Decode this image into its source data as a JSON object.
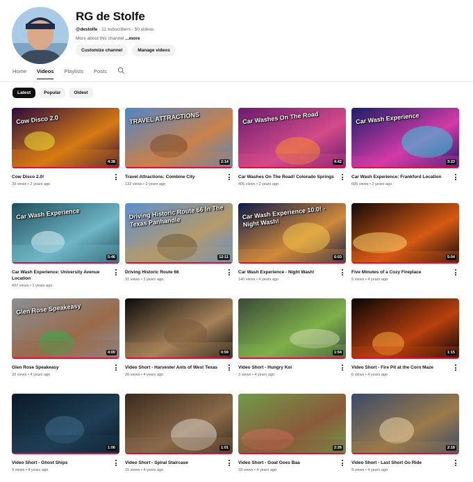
{
  "channel": {
    "name": "RG de Stolfe",
    "handle": "@destolfe",
    "subscribers": "11 subscribers",
    "videos_count": "50 videos",
    "about_text": "More about this channel",
    "about_more": "...more",
    "customize_label": "Customize channel",
    "manage_label": "Manage videos"
  },
  "tabs": [
    {
      "label": "Home",
      "active": false
    },
    {
      "label": "Videos",
      "active": true
    },
    {
      "label": "Playlists",
      "active": false
    },
    {
      "label": "Posts",
      "active": false
    }
  ],
  "filters": [
    {
      "label": "Latest",
      "active": true
    },
    {
      "label": "Popular",
      "active": false
    },
    {
      "label": "Oldest",
      "active": false
    }
  ],
  "videos": [
    {
      "title": "Cow Disco 2.0!",
      "meta": "39 views • 2 years ago",
      "duration": "4:38",
      "thumb_text": "Cow Disco 2.0",
      "palette": [
        "#2b0a3d",
        "#d67a12",
        "#f2e034"
      ]
    },
    {
      "title": "Travel Attractions: Combine City",
      "meta": "132 views • 2 years ago",
      "duration": "2:14",
      "thumb_text": "TRAVEL ATTRACTIONS",
      "palette": [
        "#4f86c6",
        "#c9824a",
        "#7a4a2a"
      ]
    },
    {
      "title": "Car Washes On The Road! Colorado Springs",
      "meta": "406 views • 2 years ago",
      "duration": "4:42",
      "thumb_text": "Car Washes On The Road",
      "palette": [
        "#6a1c6e",
        "#d44a8a",
        "#f58a2a"
      ]
    },
    {
      "title": "Car Wash Experience: Frankford Location",
      "meta": "605 views • 2 years ago",
      "duration": "3:23",
      "thumb_text": "Car Wash Experience",
      "palette": [
        "#1a1f6b",
        "#d43aa8",
        "#2ad2e0"
      ]
    },
    {
      "title": "Car Wash Experience: University Avenue Location",
      "meta": "437 views • 2 years ago",
      "duration": "5:46",
      "thumb_text": "Car Wash Experience",
      "palette": [
        "#1d4e5c",
        "#6fb6c6",
        "#d8eef2"
      ]
    },
    {
      "title": "Driving Historic Route 66",
      "meta": "31 views • 3 years ago",
      "duration": "12:11",
      "thumb_text": "Driving Historic Route 66 In The Texas Panhandle",
      "palette": [
        "#5b8fd0",
        "#b59a6a",
        "#6d5a3a"
      ]
    },
    {
      "title": "Car Wash Experience - Night Wash!",
      "meta": "140 views • 4 years ago",
      "duration": "6:03",
      "thumb_text": "Car Wash Experience 10.0! - Night Wash!",
      "palette": [
        "#0d1a4a",
        "#d08a3a",
        "#f2c24a"
      ]
    },
    {
      "title": "Five Minutes of a Cozy Fireplace",
      "meta": "5 views • 4 years ago",
      "duration": "5:04",
      "thumb_text": "",
      "palette": [
        "#120a08",
        "#d65a14",
        "#fbd16a"
      ]
    },
    {
      "title": "Glen Rose Speakeasy",
      "meta": "33 views • 4 years ago",
      "duration": "4:00",
      "thumb_text": "Glen Rose Speakeasy",
      "palette": [
        "#8a8f95",
        "#9a6a4a",
        "#2fae4a"
      ]
    },
    {
      "title": "Video Short - Harvester Ants of West Texas",
      "meta": "20 views • 4 years ago",
      "duration": "0:59",
      "thumb_text": "",
      "palette": [
        "#0a0a0a",
        "#a6825a",
        "#7a5a3a"
      ]
    },
    {
      "title": "Video Short - Hungry Koi",
      "meta": "3 views • 4 years ago",
      "duration": "1:54",
      "thumb_text": "",
      "palette": [
        "#3a4a3a",
        "#7fb04a",
        "#c8d8a8"
      ]
    },
    {
      "title": "Video Short - Fire Pit at the Corn Maze",
      "meta": "6 views • 4 years ago",
      "duration": "1:15",
      "thumb_text": "",
      "palette": [
        "#080606",
        "#b8400e",
        "#f5a53a"
      ]
    },
    {
      "title": "Video Short - Ghost Ships",
      "meta": "9 views • 4 years ago",
      "duration": "1:06",
      "thumb_text": "",
      "palette": [
        "#0a1a26",
        "#1f3e55",
        "#3e6a86"
      ]
    },
    {
      "title": "Video Short - Spiral Staircase",
      "meta": "15 views • 4 years ago",
      "duration": "1:01",
      "thumb_text": "",
      "palette": [
        "#3a2a1c",
        "#8a6a4a",
        "#d8d2c8"
      ]
    },
    {
      "title": "Video Short - Goat Goes Baa",
      "meta": "18 views • 4 years ago",
      "duration": "2:26",
      "thumb_text": "",
      "palette": [
        "#6f9a4a",
        "#8a5a3a",
        "#c86a5a"
      ]
    },
    {
      "title": "Video Short - Last Short Go Ride",
      "meta": "9 views • 4 years ago",
      "duration": "2:18",
      "thumb_text": "",
      "palette": [
        "#3a4a6a",
        "#9a7a4a",
        "#e8d2a8"
      ]
    }
  ],
  "colors": {
    "progress": "#ff0033",
    "chip_active": "#0f0f0f"
  },
  "icons": {
    "search": "search-icon",
    "more": "more-vert-icon"
  }
}
